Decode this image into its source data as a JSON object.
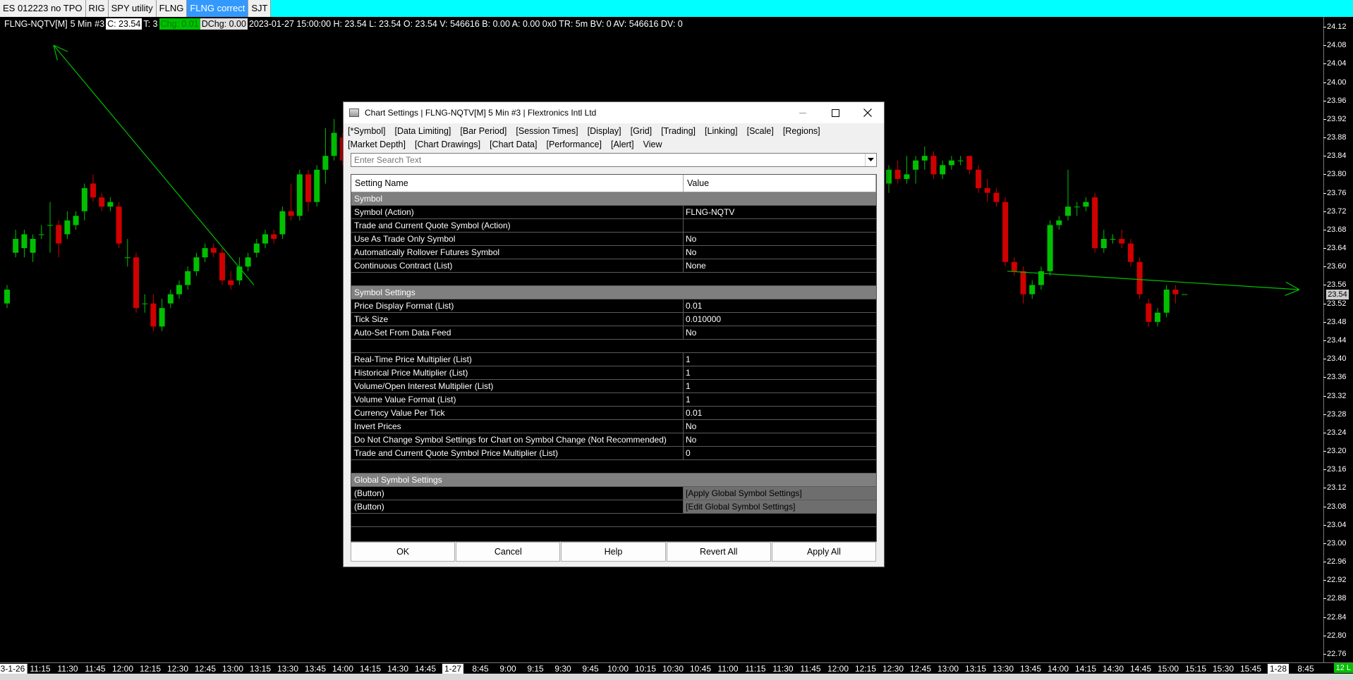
{
  "tabs": [
    {
      "label": "ES 012223 no TPO",
      "active": false
    },
    {
      "label": "RIG",
      "active": false
    },
    {
      "label": "SPY utility",
      "active": false
    },
    {
      "label": "FLNG",
      "active": false
    },
    {
      "label": "FLNG correct",
      "active": true
    },
    {
      "label": "SJT",
      "active": false
    }
  ],
  "info": {
    "symbol": "FLNG-NQTV[M]",
    "period": "5 Min",
    "chart_num": "#3",
    "close": "C: 23.54",
    "trades": "T: 3",
    "change": "Chg: 0.01",
    "dchange": "DChg: 0.00",
    "details": "2023-01-27 15:00:00 H: 23.54 L: 23.54 O: 23.54 V: 546616 B: 0.00 A: 0.00 0x0 TR: 5m BV: 0 AV: 546616 DV: 0"
  },
  "price_axis": {
    "ticks": [
      "24.12",
      "24.08",
      "24.04",
      "24.00",
      "23.96",
      "23.92",
      "23.88",
      "23.84",
      "23.80",
      "23.76",
      "23.72",
      "23.68",
      "23.64",
      "23.60",
      "23.56",
      "23.52",
      "23.48",
      "23.44",
      "23.40",
      "23.36",
      "23.32",
      "23.28",
      "23.24",
      "23.20",
      "23.16",
      "23.12",
      "23.08",
      "23.04",
      "23.00",
      "22.96",
      "22.92",
      "22.88",
      "22.84",
      "22.80",
      "22.76"
    ],
    "current_price": "23.54"
  },
  "time_axis": {
    "labels": [
      {
        "text": "3-1-26",
        "date": true
      },
      {
        "text": "11:15"
      },
      {
        "text": "11:30"
      },
      {
        "text": "11:45"
      },
      {
        "text": "12:00"
      },
      {
        "text": "12:15"
      },
      {
        "text": "12:30"
      },
      {
        "text": "12:45"
      },
      {
        "text": "13:00"
      },
      {
        "text": "13:15"
      },
      {
        "text": "13:30"
      },
      {
        "text": "13:45"
      },
      {
        "text": "14:00"
      },
      {
        "text": "14:15"
      },
      {
        "text": "14:30"
      },
      {
        "text": "14:45"
      },
      {
        "text": "1-27",
        "date": true
      },
      {
        "text": "8:45"
      },
      {
        "text": "9:00"
      },
      {
        "text": "9:15"
      },
      {
        "text": "9:30"
      },
      {
        "text": "9:45"
      },
      {
        "text": "10:00"
      },
      {
        "text": "10:15"
      },
      {
        "text": "10:30"
      },
      {
        "text": "10:45"
      },
      {
        "text": "11:00"
      },
      {
        "text": "11:15"
      },
      {
        "text": "11:30"
      },
      {
        "text": "11:45"
      },
      {
        "text": "12:00"
      },
      {
        "text": "12:15"
      },
      {
        "text": "12:30"
      },
      {
        "text": "12:45"
      },
      {
        "text": "13:00"
      },
      {
        "text": "13:15"
      },
      {
        "text": "13:30"
      },
      {
        "text": "13:45"
      },
      {
        "text": "14:00"
      },
      {
        "text": "14:15"
      },
      {
        "text": "14:30"
      },
      {
        "text": "14:45"
      },
      {
        "text": "15:00"
      },
      {
        "text": "15:15"
      },
      {
        "text": "15:30"
      },
      {
        "text": "15:45"
      },
      {
        "text": "1-28",
        "date": true
      },
      {
        "text": "8:45"
      }
    ],
    "badge": "12 L"
  },
  "candles": [
    {
      "o": 23.52,
      "h": 23.56,
      "l": 23.51,
      "c": 23.55
    },
    {
      "o": 23.63,
      "h": 23.68,
      "l": 23.62,
      "c": 23.66
    },
    {
      "o": 23.64,
      "h": 23.68,
      "l": 23.62,
      "c": 23.67
    },
    {
      "o": 23.63,
      "h": 23.67,
      "l": 23.61,
      "c": 23.66
    },
    {
      "o": 23.67,
      "h": 23.69,
      "l": 23.66,
      "c": 23.67
    },
    {
      "o": 23.69,
      "h": 23.74,
      "l": 23.63,
      "c": 23.69
    },
    {
      "o": 23.69,
      "h": 23.7,
      "l": 23.62,
      "c": 23.65
    },
    {
      "o": 23.67,
      "h": 23.72,
      "l": 23.66,
      "c": 23.7
    },
    {
      "o": 23.69,
      "h": 23.72,
      "l": 23.68,
      "c": 23.71
    },
    {
      "o": 23.72,
      "h": 23.78,
      "l": 23.7,
      "c": 23.77
    },
    {
      "o": 23.78,
      "h": 23.8,
      "l": 23.74,
      "c": 23.75
    },
    {
      "o": 23.75,
      "h": 23.76,
      "l": 23.72,
      "c": 23.73
    },
    {
      "o": 23.73,
      "h": 23.75,
      "l": 23.72,
      "c": 23.74
    },
    {
      "o": 23.73,
      "h": 23.74,
      "l": 23.64,
      "c": 23.65
    },
    {
      "o": 23.62,
      "h": 23.66,
      "l": 23.6,
      "c": 23.62
    },
    {
      "o": 23.62,
      "h": 23.63,
      "l": 23.5,
      "c": 23.51
    },
    {
      "o": 23.52,
      "h": 23.54,
      "l": 23.5,
      "c": 23.52
    },
    {
      "o": 23.52,
      "h": 23.54,
      "l": 23.46,
      "c": 23.47
    },
    {
      "o": 23.47,
      "h": 23.53,
      "l": 23.46,
      "c": 23.51
    },
    {
      "o": 23.52,
      "h": 23.55,
      "l": 23.51,
      "c": 23.54
    },
    {
      "o": 23.54,
      "h": 23.57,
      "l": 23.53,
      "c": 23.56
    },
    {
      "o": 23.56,
      "h": 23.6,
      "l": 23.55,
      "c": 23.59
    },
    {
      "o": 23.59,
      "h": 23.63,
      "l": 23.58,
      "c": 23.62
    },
    {
      "o": 23.62,
      "h": 23.65,
      "l": 23.61,
      "c": 23.64
    },
    {
      "o": 23.64,
      "h": 23.65,
      "l": 23.62,
      "c": 23.63
    },
    {
      "o": 23.63,
      "h": 23.64,
      "l": 23.56,
      "c": 23.57
    },
    {
      "o": 23.57,
      "h": 23.59,
      "l": 23.55,
      "c": 23.56
    },
    {
      "o": 23.57,
      "h": 23.62,
      "l": 23.56,
      "c": 23.6
    },
    {
      "o": 23.6,
      "h": 23.63,
      "l": 23.59,
      "c": 23.62
    },
    {
      "o": 23.63,
      "h": 23.66,
      "l": 23.62,
      "c": 23.65
    },
    {
      "o": 23.65,
      "h": 23.68,
      "l": 23.64,
      "c": 23.67
    },
    {
      "o": 23.67,
      "h": 23.68,
      "l": 23.65,
      "c": 23.66
    },
    {
      "o": 23.67,
      "h": 23.73,
      "l": 23.66,
      "c": 23.72
    },
    {
      "o": 23.72,
      "h": 23.78,
      "l": 23.7,
      "c": 23.71
    },
    {
      "o": 23.71,
      "h": 23.81,
      "l": 23.7,
      "c": 23.8
    },
    {
      "o": 23.8,
      "h": 23.81,
      "l": 23.72,
      "c": 23.74
    },
    {
      "o": 23.74,
      "h": 23.82,
      "l": 23.73,
      "c": 23.81
    },
    {
      "o": 23.81,
      "h": 23.9,
      "l": 23.78,
      "c": 23.84
    },
    {
      "o": 23.84,
      "h": 23.92,
      "l": 23.83,
      "c": 23.89
    },
    {
      "o": 23.88,
      "h": 23.89,
      "l": 23.82,
      "c": 23.83
    }
  ],
  "candles_right": [
    {
      "o": 23.78,
      "h": 23.82,
      "l": 23.76,
      "c": 23.81
    },
    {
      "o": 23.81,
      "h": 23.83,
      "l": 23.78,
      "c": 23.79
    },
    {
      "o": 23.79,
      "h": 23.84,
      "l": 23.78,
      "c": 23.8
    },
    {
      "o": 23.81,
      "h": 23.84,
      "l": 23.78,
      "c": 23.83
    },
    {
      "o": 23.83,
      "h": 23.86,
      "l": 23.81,
      "c": 23.84
    },
    {
      "o": 23.84,
      "h": 23.85,
      "l": 23.79,
      "c": 23.8
    },
    {
      "o": 23.8,
      "h": 23.83,
      "l": 23.79,
      "c": 23.82
    },
    {
      "o": 23.82,
      "h": 23.84,
      "l": 23.81,
      "c": 23.83
    },
    {
      "o": 23.83,
      "h": 23.84,
      "l": 23.82,
      "c": 23.83
    },
    {
      "o": 23.84,
      "h": 23.84,
      "l": 23.8,
      "c": 23.81
    },
    {
      "o": 23.81,
      "h": 23.82,
      "l": 23.76,
      "c": 23.77
    },
    {
      "o": 23.77,
      "h": 23.79,
      "l": 23.74,
      "c": 23.76
    },
    {
      "o": 23.76,
      "h": 23.77,
      "l": 23.73,
      "c": 23.74
    },
    {
      "o": 23.74,
      "h": 23.75,
      "l": 23.6,
      "c": 23.61
    },
    {
      "o": 23.61,
      "h": 23.62,
      "l": 23.58,
      "c": 23.59
    },
    {
      "o": 23.59,
      "h": 23.6,
      "l": 23.52,
      "c": 23.54
    },
    {
      "o": 23.54,
      "h": 23.57,
      "l": 23.53,
      "c": 23.56
    },
    {
      "o": 23.56,
      "h": 23.6,
      "l": 23.55,
      "c": 23.59
    },
    {
      "o": 23.59,
      "h": 23.7,
      "l": 23.58,
      "c": 23.69
    },
    {
      "o": 23.69,
      "h": 23.71,
      "l": 23.68,
      "c": 23.7
    },
    {
      "o": 23.71,
      "h": 23.81,
      "l": 23.7,
      "c": 23.73
    },
    {
      "o": 23.73,
      "h": 23.74,
      "l": 23.71,
      "c": 23.73
    },
    {
      "o": 23.73,
      "h": 23.75,
      "l": 23.72,
      "c": 23.74
    },
    {
      "o": 23.75,
      "h": 23.76,
      "l": 23.63,
      "c": 23.64
    },
    {
      "o": 23.64,
      "h": 23.68,
      "l": 23.63,
      "c": 23.66
    },
    {
      "o": 23.66,
      "h": 23.67,
      "l": 23.65,
      "c": 23.66
    },
    {
      "o": 23.66,
      "h": 23.68,
      "l": 23.64,
      "c": 23.65
    },
    {
      "o": 23.65,
      "h": 23.66,
      "l": 23.6,
      "c": 23.61
    },
    {
      "o": 23.61,
      "h": 23.62,
      "l": 23.53,
      "c": 23.54
    },
    {
      "o": 23.52,
      "h": 23.53,
      "l": 23.47,
      "c": 23.48
    },
    {
      "o": 23.48,
      "h": 23.51,
      "l": 23.47,
      "c": 23.5
    },
    {
      "o": 23.5,
      "h": 23.56,
      "l": 23.49,
      "c": 23.55
    },
    {
      "o": 23.55,
      "h": 23.56,
      "l": 23.52,
      "c": 23.54
    },
    {
      "o": 23.54,
      "h": 23.54,
      "l": 23.54,
      "c": 23.54
    }
  ],
  "drawings": {
    "line1": {
      "from_price": 24.08,
      "to_price": 23.56,
      "color": "#00c000"
    },
    "line2": {
      "from_price": 23.59,
      "to_price": 23.55,
      "color": "#00c000"
    }
  },
  "colors": {
    "up": "#00c000",
    "down": "#d00000",
    "tabbar": "#00ffff",
    "grid_section": "#7f7f7f"
  },
  "dialog": {
    "title": "Chart Settings | FLNG-NQTV[M]  5 Min   #3 | Flextronics Intl Ltd",
    "menu": [
      "[*Symbol]",
      "[Data Limiting]",
      "[Bar Period]",
      "[Session Times]",
      "[Display]",
      "[Grid]",
      "[Trading]",
      "[Linking]",
      "[Scale]",
      "[Regions]",
      "[Market Depth]",
      "[Chart Drawings]",
      "[Chart Data]",
      "[Performance]",
      "[Alert]",
      "View"
    ],
    "search_placeholder": "Enter Search Text",
    "columns": {
      "name": "Setting Name",
      "value": "Value"
    },
    "rows": [
      {
        "type": "section",
        "name": "Symbol"
      },
      {
        "type": "item",
        "name": "Symbol (Action)",
        "value": "FLNG-NQTV"
      },
      {
        "type": "item",
        "name": "Trade and Current Quote Symbol (Action)",
        "value": ""
      },
      {
        "type": "item",
        "name": "Use As Trade Only Symbol",
        "value": "No"
      },
      {
        "type": "item",
        "name": "Automatically Rollover Futures Symbol",
        "value": "No"
      },
      {
        "type": "item",
        "name": "Continuous Contract (List)",
        "value": "None"
      },
      {
        "type": "spacer"
      },
      {
        "type": "section",
        "name": "Symbol Settings"
      },
      {
        "type": "item",
        "name": "Price Display Format (List)",
        "value": "0.01"
      },
      {
        "type": "item",
        "name": "Tick Size",
        "value": "0.010000"
      },
      {
        "type": "item",
        "name": "Auto-Set From Data Feed",
        "value": "No"
      },
      {
        "type": "spacer"
      },
      {
        "type": "item",
        "name": "Real-Time Price Multiplier (List)",
        "value": "1"
      },
      {
        "type": "item",
        "name": "Historical Price Multiplier (List)",
        "value": "1"
      },
      {
        "type": "item",
        "name": "Volume/Open Interest Multiplier (List)",
        "value": "1"
      },
      {
        "type": "item",
        "name": "Volume Value Format (List)",
        "value": "1"
      },
      {
        "type": "item",
        "name": "Currency Value Per Tick",
        "value": "0.01"
      },
      {
        "type": "item",
        "name": "Invert Prices",
        "value": "No"
      },
      {
        "type": "item",
        "name": "Do Not Change Symbol Settings for Chart on Symbol Change (Not Recommended)",
        "value": "No"
      },
      {
        "type": "item",
        "name": "Trade and Current Quote Symbol Price Multiplier (List)",
        "value": "0"
      },
      {
        "type": "spacer"
      },
      {
        "type": "section",
        "name": "Global Symbol Settings"
      },
      {
        "type": "button",
        "name": " (Button)",
        "value": "[Apply Global Symbol Settings]"
      },
      {
        "type": "button",
        "name": " (Button)",
        "value": "[Edit Global Symbol Settings]"
      },
      {
        "type": "spacer"
      }
    ],
    "buttons": [
      "OK",
      "Cancel",
      "Help",
      "Revert All",
      "Apply All"
    ]
  }
}
